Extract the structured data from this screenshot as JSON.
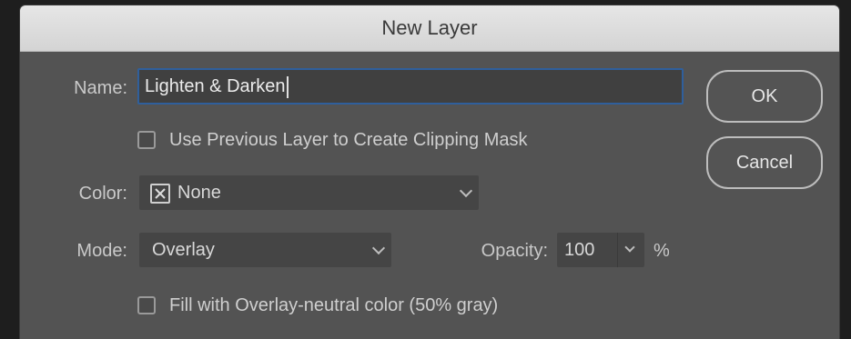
{
  "dialog": {
    "title": "New Layer"
  },
  "name": {
    "label": "Name:",
    "value": "Lighten & Darken"
  },
  "clipping": {
    "label": "Use Previous Layer to Create Clipping Mask",
    "checked": false
  },
  "color": {
    "label": "Color:",
    "value": "None",
    "swatch_icon": "none-swatch-icon"
  },
  "mode": {
    "label": "Mode:",
    "value": "Overlay"
  },
  "opacity": {
    "label": "Opacity:",
    "value": "100",
    "unit": "%"
  },
  "fill_neutral": {
    "label": "Fill with Overlay-neutral color (50% gray)",
    "checked": false
  },
  "buttons": {
    "ok": "OK",
    "cancel": "Cancel"
  },
  "colors": {
    "dialog_bg": "#535353",
    "titlebar_bg": "#dcdcdc",
    "field_bg": "#454545",
    "focus_border": "#2f5f9c"
  }
}
